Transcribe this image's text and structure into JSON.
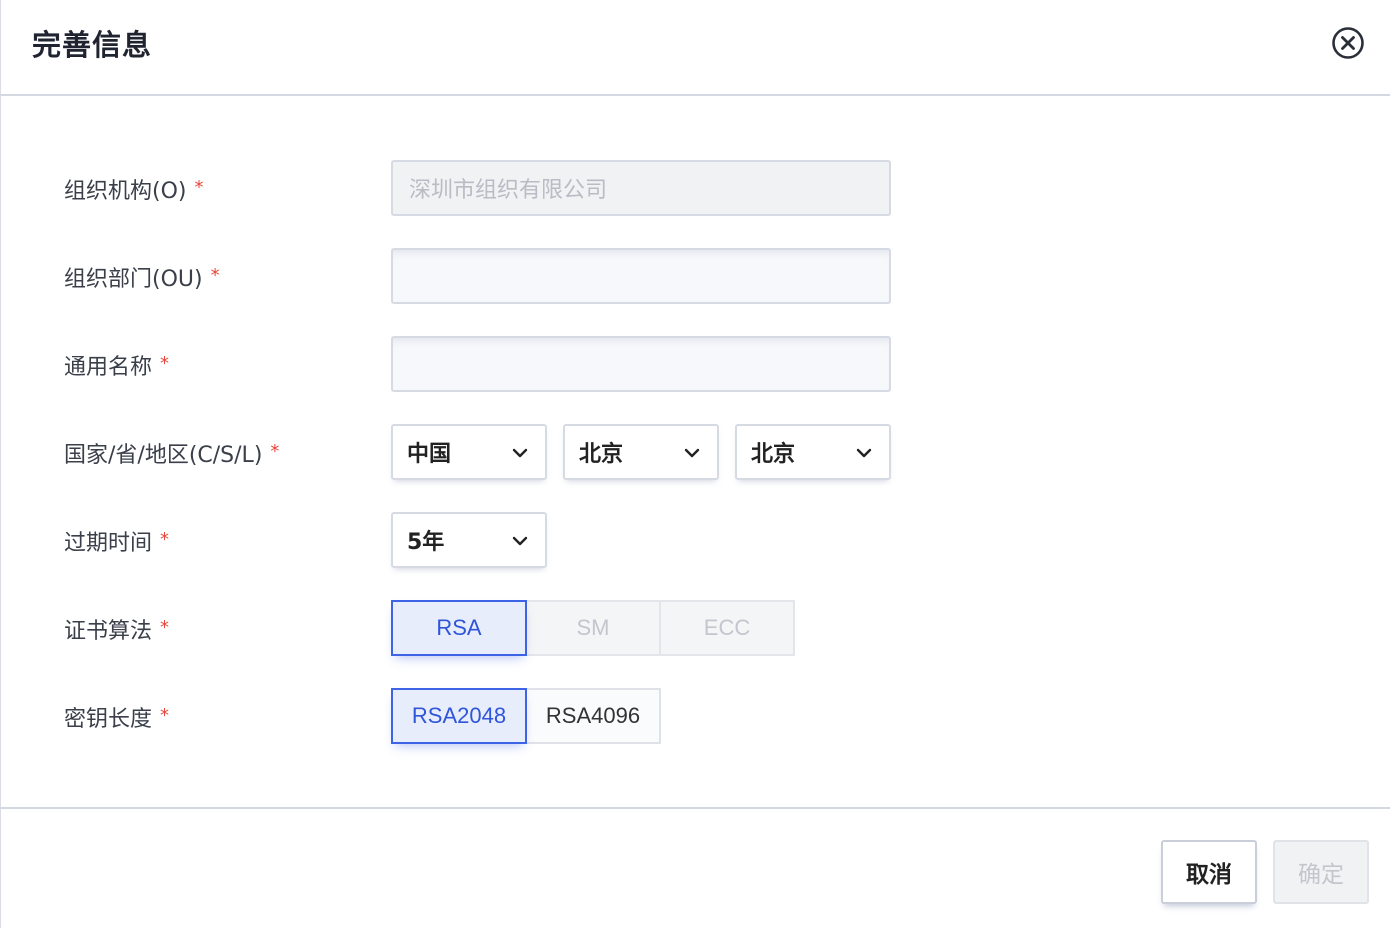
{
  "dialog": {
    "title": "完善信息"
  },
  "form": {
    "org": {
      "label": "组织机构(O)",
      "required": "*",
      "value": "深圳市组织有限公司"
    },
    "ou": {
      "label": "组织部门(OU)",
      "required": "*",
      "value": ""
    },
    "cn": {
      "label": "通用名称",
      "required": "*",
      "value": ""
    },
    "location": {
      "label": "国家/省/地区(C/S/L)",
      "required": "*",
      "country": "中国",
      "province": "北京",
      "city": "北京"
    },
    "expiry": {
      "label": "过期时间",
      "required": "*",
      "value": "5年"
    },
    "algorithm": {
      "label": "证书算法",
      "required": "*",
      "options": [
        "RSA",
        "SM",
        "ECC"
      ],
      "selected": "RSA"
    },
    "key_length": {
      "label": "密钥长度",
      "required": "*",
      "options": [
        "RSA2048",
        "RSA4096"
      ],
      "selected": "RSA2048"
    }
  },
  "footer": {
    "cancel_label": "取消",
    "confirm_label": "确定"
  },
  "colors": {
    "accent": "#3d63e6",
    "required": "#e8453c",
    "disabled_text": "#c2c6cd"
  }
}
